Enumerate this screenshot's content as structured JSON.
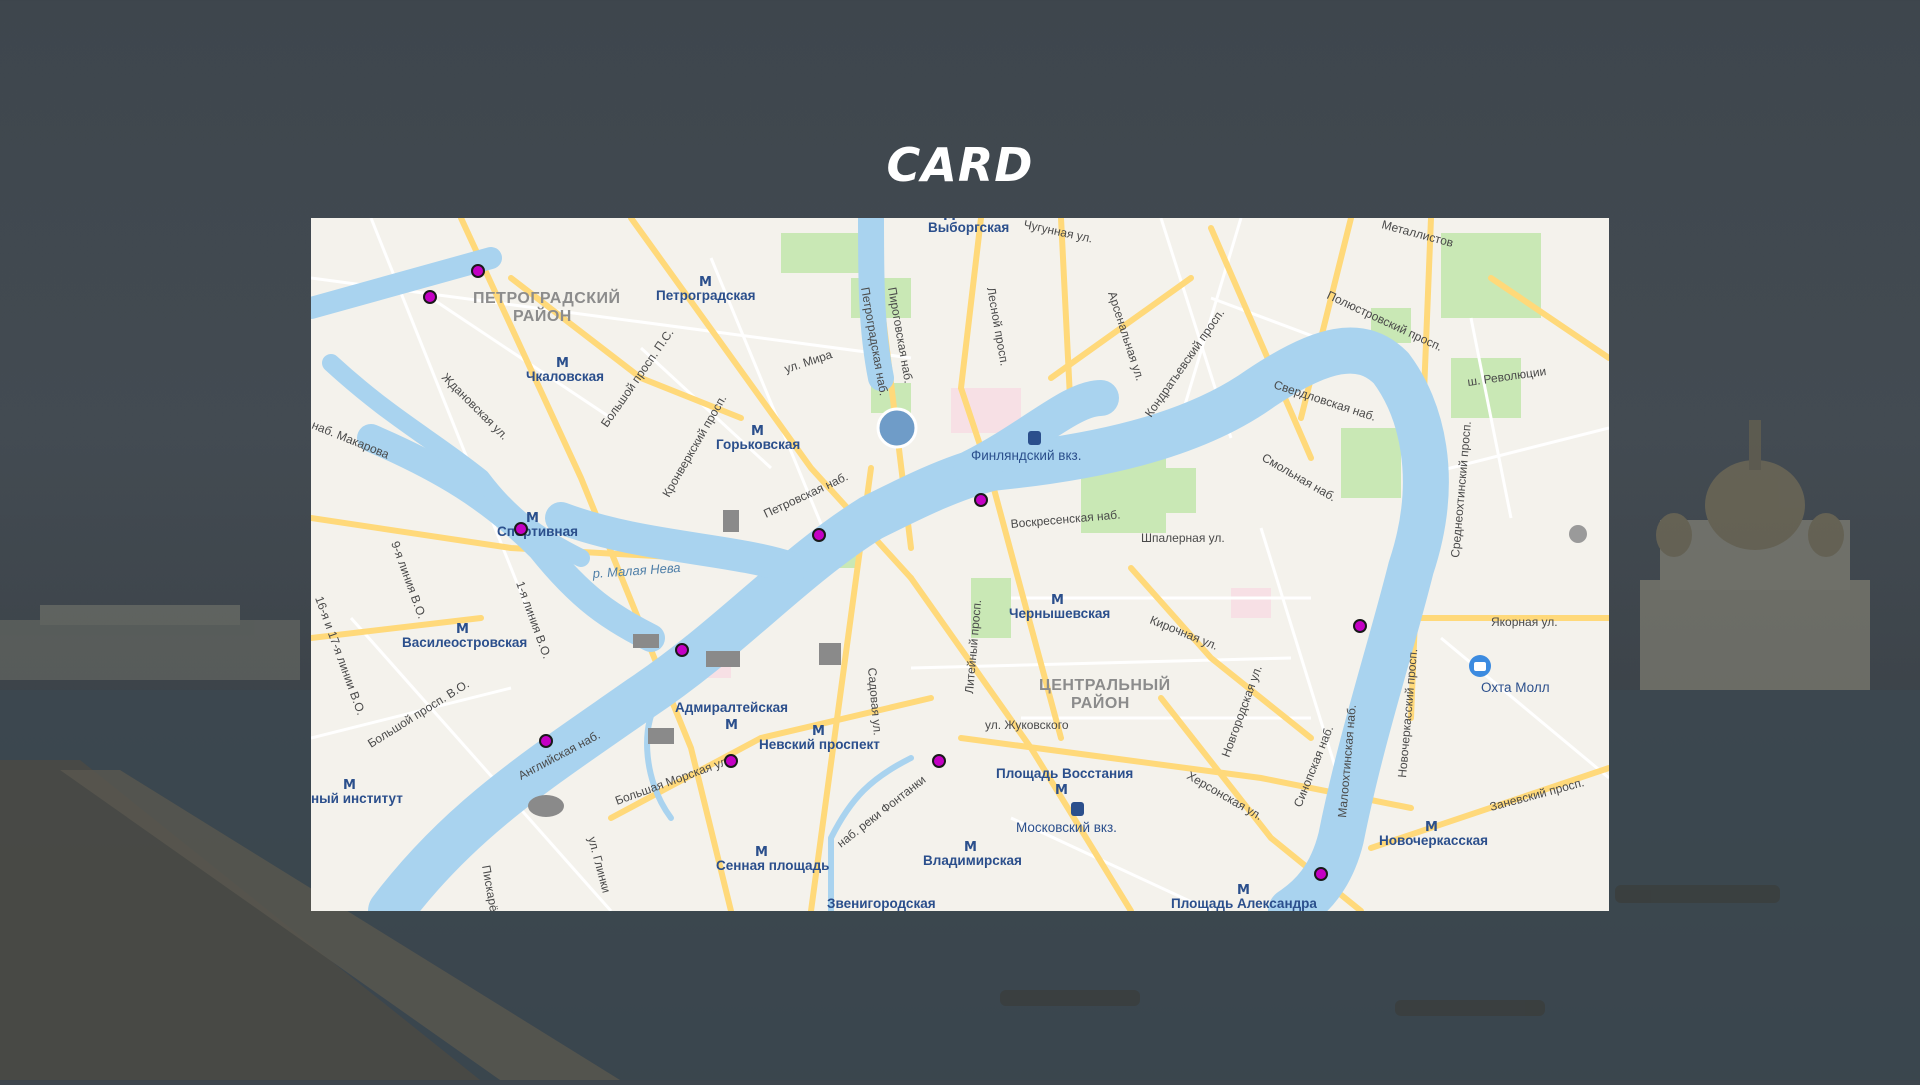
{
  "page": {
    "title": "CARD"
  },
  "colors": {
    "background": "#3e464d",
    "water": "#a9d3ef",
    "land": "#f4f2ec",
    "road": "#ffd97a",
    "park": "#c9e8b5",
    "marker": "#c400c4",
    "metro": "#2b4f8c"
  },
  "map": {
    "districts": [
      "ПЕТРОГРАДСКИЙ РАЙОН",
      "ЦЕНТРАЛЬНЫЙ РАЙОН"
    ],
    "metro_stations": [
      "Выборгская",
      "Петроградская",
      "Чкаловская",
      "Горьковская",
      "Спортивная",
      "Василеостровская",
      "Адмиралтейская",
      "Невский проспект",
      "Чернышевская",
      "Площадь Восстания",
      "Владимирская",
      "Сенная площадь",
      "Новочеркасская",
      "ный институт",
      "Площадь Александра",
      "Звенигородская"
    ],
    "places": [
      "Финляндский вкз.",
      "Московский вкз.",
      "Охта Молл"
    ],
    "streets": [
      "ул. Мира",
      "Большой просп. П.С.",
      "Кронверкский просп.",
      "Петроградская наб.",
      "Пироговская наб.",
      "Лесной просп.",
      "Арсенальная ул.",
      "Кондратьевский просп.",
      "Свердловская наб.",
      "Полюстровский просп.",
      "ш. Революции",
      "Смольная наб.",
      "Воскресенская наб.",
      "Шпалерная ул.",
      "Кирочная ул.",
      "Литейный просп.",
      "Садовая ул.",
      "ул. Жуковского",
      "Английская наб.",
      "Большая Морская ул.",
      "наб. реки Фонтанки",
      "Новгородская ул.",
      "Синопская наб.",
      "Малоохтинская наб.",
      "Якорная ул.",
      "Заневский просп.",
      "Херсонская ул.",
      "Петровская наб.",
      "Ждановская ул.",
      "наб. Макарова",
      "9-я линия В.О.",
      "1-я линия В.О.",
      "16-я и 17-я линии В.О.",
      "Большой просп. В.О.",
      "Новочеркасский просп.",
      "Среднеохтинский просп.",
      "ул. Глинки",
      "Пискарёвский",
      "Металлистов",
      "Чугунная ул."
    ],
    "rivers": [
      "р. Малая Нева"
    ],
    "markers_count": 11
  }
}
